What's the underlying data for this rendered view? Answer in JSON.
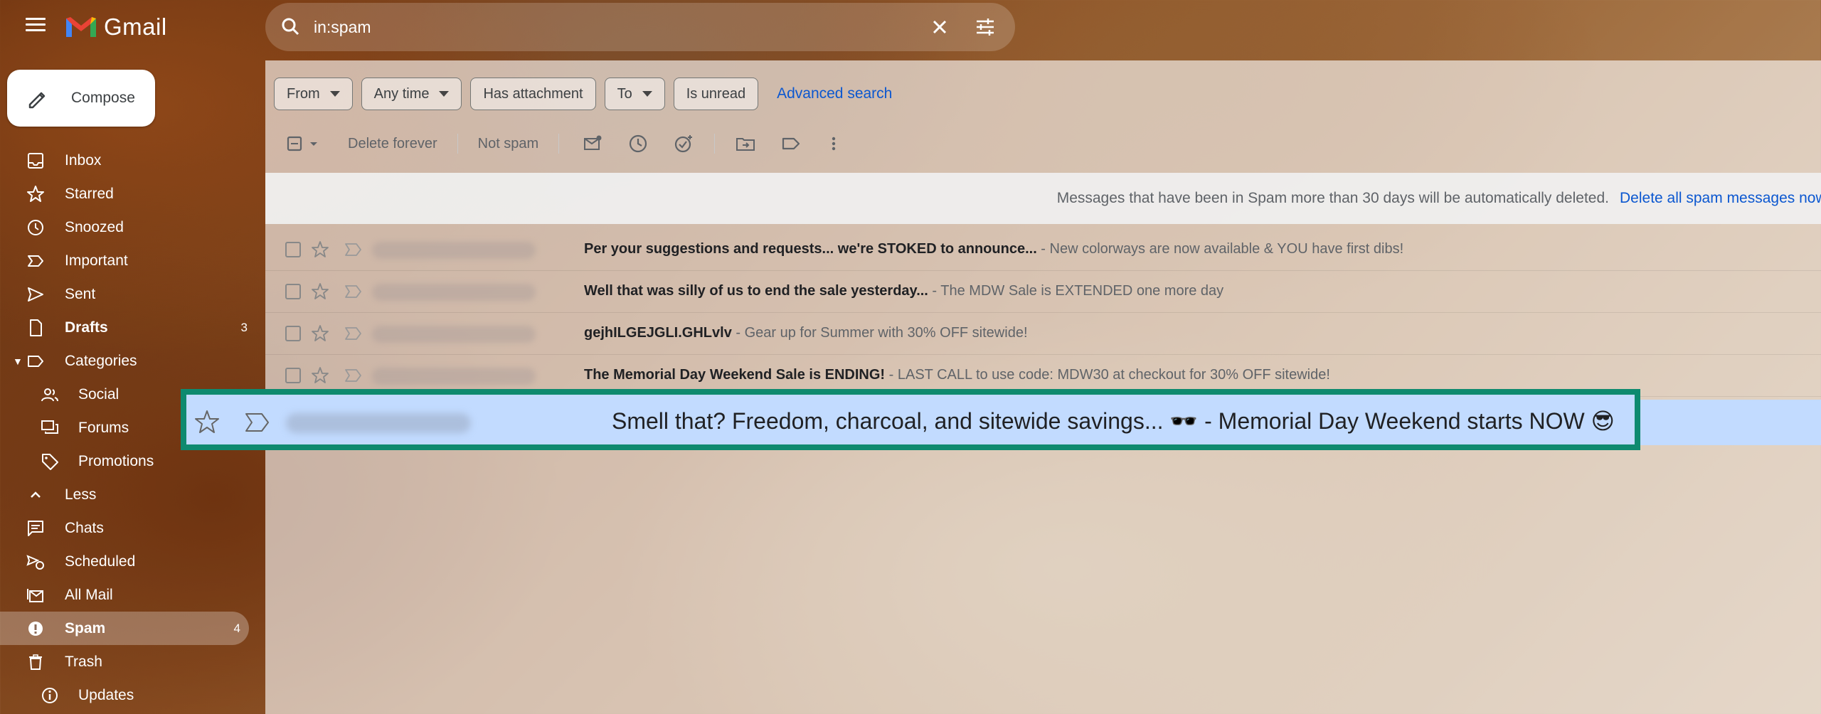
{
  "app": {
    "name": "Gmail"
  },
  "search": {
    "value": "in:spam"
  },
  "compose": {
    "label": "Compose"
  },
  "sidebar": {
    "items": [
      {
        "label": "Inbox",
        "icon": "inbox-icon"
      },
      {
        "label": "Starred",
        "icon": "star-icon"
      },
      {
        "label": "Snoozed",
        "icon": "clock-icon"
      },
      {
        "label": "Important",
        "icon": "important-icon"
      },
      {
        "label": "Sent",
        "icon": "send-icon"
      },
      {
        "label": "Drafts",
        "icon": "draft-icon",
        "count": "3"
      },
      {
        "label": "Categories",
        "icon": "label-icon"
      },
      {
        "label": "Social",
        "icon": "people-icon"
      },
      {
        "label": "Forums",
        "icon": "forum-icon"
      },
      {
        "label": "Promotions",
        "icon": "tag-icon"
      },
      {
        "label": "Less",
        "icon": "chevron-up-icon"
      },
      {
        "label": "Chats",
        "icon": "chat-icon"
      },
      {
        "label": "Scheduled",
        "icon": "scheduled-send-icon"
      },
      {
        "label": "All Mail",
        "icon": "all-mail-icon"
      },
      {
        "label": "Spam",
        "icon": "spam-icon",
        "count": "4"
      },
      {
        "label": "Trash",
        "icon": "trash-icon"
      },
      {
        "label": "Updates",
        "icon": "info-icon"
      }
    ]
  },
  "filters": {
    "from": "From",
    "any_time": "Any time",
    "has_attachment": "Has attachment",
    "to": "To",
    "is_unread": "Is unread",
    "advanced_search": "Advanced search"
  },
  "toolbar": {
    "delete_forever": "Delete forever",
    "not_spam": "Not spam"
  },
  "banner": {
    "text": "Messages that have been in Spam more than 30 days will be automatically deleted.",
    "link": "Delete all spam messages now"
  },
  "emails": [
    {
      "subject": "Per your suggestions and requests... we're STOKED to announce...",
      "snippet": " - New colorways are now available & YOU have first dibs!"
    },
    {
      "subject": "Well that was silly of us to end the sale yesterday...",
      "snippet": " - The MDW Sale is EXTENDED one more day"
    },
    {
      "subject": "gejhILGEJGLI.GHLvlv",
      "snippet": " - Gear up for Summer with 30% OFF sitewide!"
    },
    {
      "subject": "The Memorial Day Weekend Sale is ENDING!",
      "snippet": " - LAST CALL to use code: MDW30 at checkout for 30% OFF sitewide!"
    }
  ],
  "highlighted_email": {
    "subject": "Smell that? Freedom, charcoal, and sitewide savings... 🕶️",
    "snippet": " - Memorial Day Weekend starts NOW 😎"
  },
  "colors": {
    "accent": "#0b57d0",
    "highlight_border": "#0e8a6f",
    "selected_row": "#c2dbff"
  }
}
